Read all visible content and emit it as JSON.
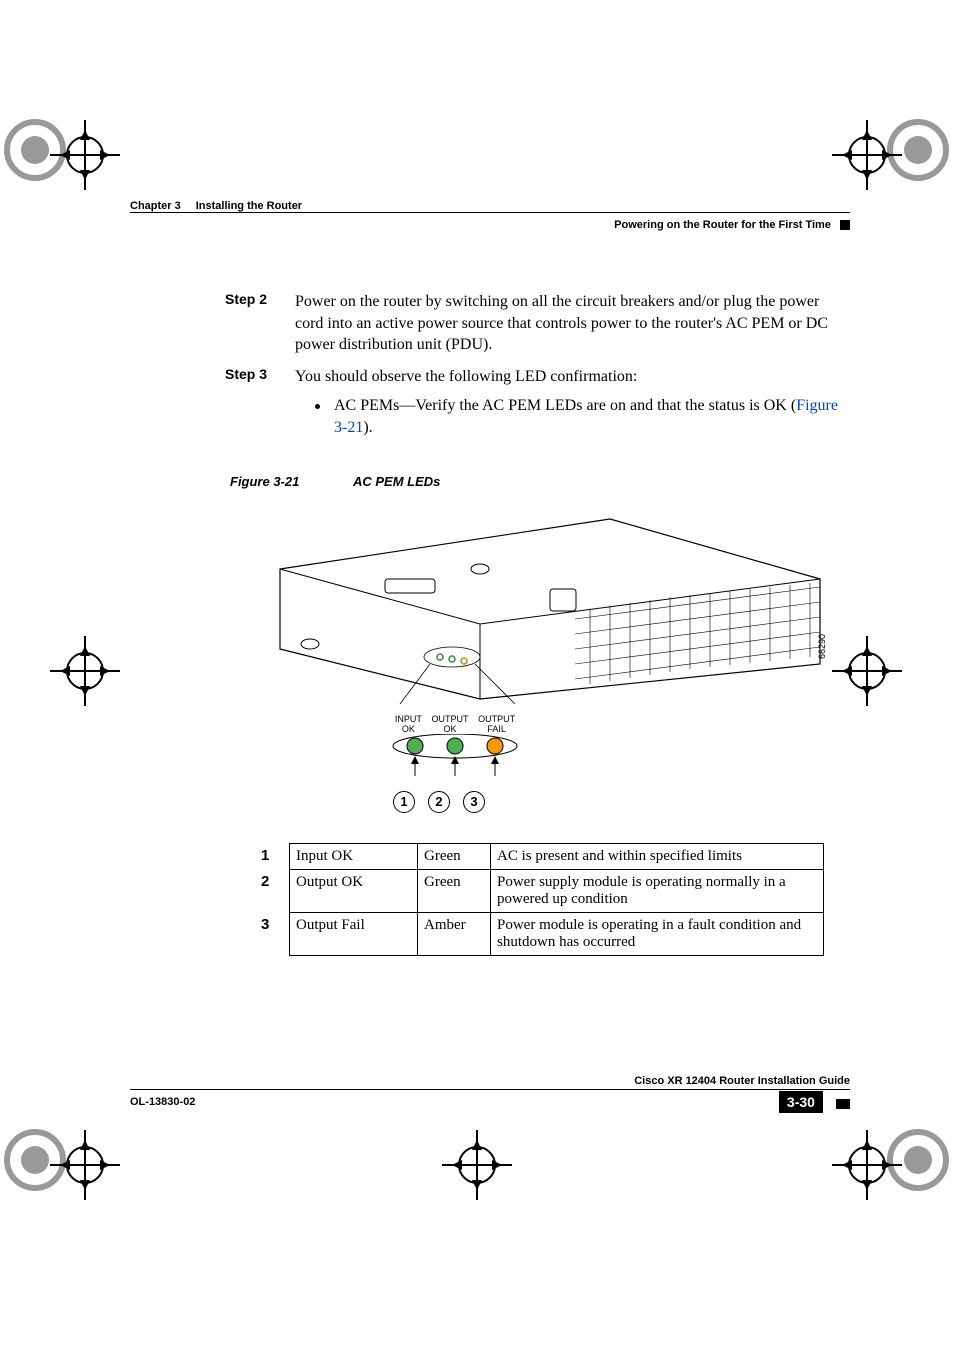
{
  "header": {
    "chapter_label": "Chapter 3",
    "chapter_title": "Installing the Router",
    "section_title": "Powering on the Router for the First Time"
  },
  "steps": [
    {
      "label": "Step 2",
      "text": "Power on the router by switching on all the circuit breakers and/or plug the power cord into an active power source that controls power to the router's AC PEM or DC power distribution unit (PDU)."
    },
    {
      "label": "Step 3",
      "text": "You should observe the following LED confirmation:",
      "bullets": [
        {
          "pre": "AC PEMs—Verify the AC PEM LEDs are on and that the status is OK (",
          "link": "Figure 3-21",
          "post": ")."
        }
      ]
    }
  ],
  "figure": {
    "label": "Figure 3-21",
    "title": "AC PEM LEDs",
    "image_id": "66290",
    "led_labels": [
      {
        "top": "INPUT",
        "bottom": "OK"
      },
      {
        "top": "OUTPUT",
        "bottom": "OK"
      },
      {
        "top": "OUTPUT",
        "bottom": "FAIL"
      }
    ],
    "callouts": [
      "1",
      "2",
      "3"
    ]
  },
  "table": [
    {
      "num": "1",
      "name": "Input OK",
      "color": "Green",
      "desc": "AC is present and within specified limits"
    },
    {
      "num": "2",
      "name": "Output OK",
      "color": "Green",
      "desc": "Power supply module is operating normally in a powered up condition"
    },
    {
      "num": "3",
      "name": "Output Fail",
      "color": "Amber",
      "desc": "Power module is operating in a fault condition and shutdown has occurred"
    }
  ],
  "footer": {
    "book_title": "Cisco XR 12404 Router Installation Guide",
    "doc_id": "OL-13830-02",
    "page": "3-30"
  }
}
